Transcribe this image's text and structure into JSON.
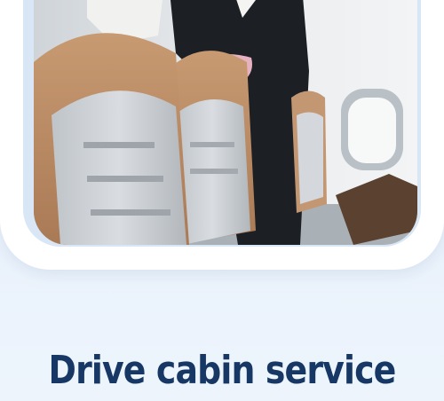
{
  "feature": {
    "title": "Drive cabin service",
    "image_alt_icon": "cabin-service-photo"
  },
  "colors": {
    "title": "#173765",
    "background": "#e6eff9",
    "card_border": "#ffffff"
  }
}
